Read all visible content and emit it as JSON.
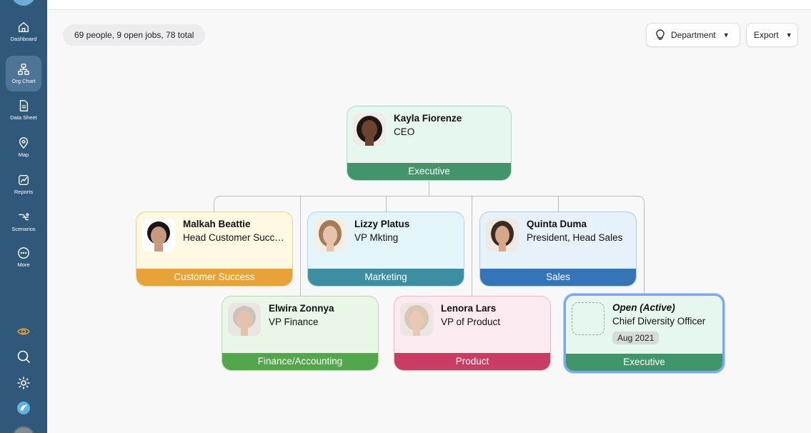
{
  "sidebar": {
    "items": [
      {
        "label": "Dashboard",
        "icon": "home-icon"
      },
      {
        "label": "Org Chart",
        "icon": "org-chart-icon",
        "active": true
      },
      {
        "label": "Data Sheet",
        "icon": "document-icon"
      },
      {
        "label": "Map",
        "icon": "map-pin-icon"
      },
      {
        "label": "Reports",
        "icon": "chart-icon"
      },
      {
        "label": "Scenarios",
        "icon": "scenarios-icon"
      },
      {
        "label": "More",
        "icon": "more-icon"
      }
    ],
    "utilities": [
      "eye-icon",
      "search-icon",
      "settings-icon",
      "app-logo-icon"
    ]
  },
  "summary": "69 people, 9 open jobs, 78 total",
  "toolbar": {
    "department_label": "Department",
    "export_label": "Export"
  },
  "org": {
    "ceo": {
      "name": "Kayla Fiorenze",
      "title": "CEO",
      "department": "Executive"
    },
    "reports": [
      {
        "name": "Malkah Beattie",
        "title": "Head Customer Succ…",
        "department": "Customer Success"
      },
      {
        "name": "Lizzy Platus",
        "title": "VP Mkting",
        "department": "Marketing"
      },
      {
        "name": "Quinta Duma",
        "title": "President, Head Sales",
        "department": "Sales"
      },
      {
        "name": "Elwira Zonnya",
        "title": "VP Finance",
        "department": "Finance/Accounting"
      },
      {
        "name": "Lenora Lars",
        "title": "VP of Product",
        "department": "Product"
      },
      {
        "name": "Open (Active)",
        "title": "Chief Diversity Officer",
        "department": "Executive",
        "date": "Aug 2021",
        "open": true
      }
    ]
  },
  "colors": {
    "sidebar": "#2f587b",
    "executive": "#41956b",
    "customer_success": "#e8a23a",
    "marketing": "#3e8ea1",
    "sales": "#3474b7",
    "finance": "#54a64d",
    "product": "#c93d64",
    "accent_eye": "#e4a43a"
  }
}
